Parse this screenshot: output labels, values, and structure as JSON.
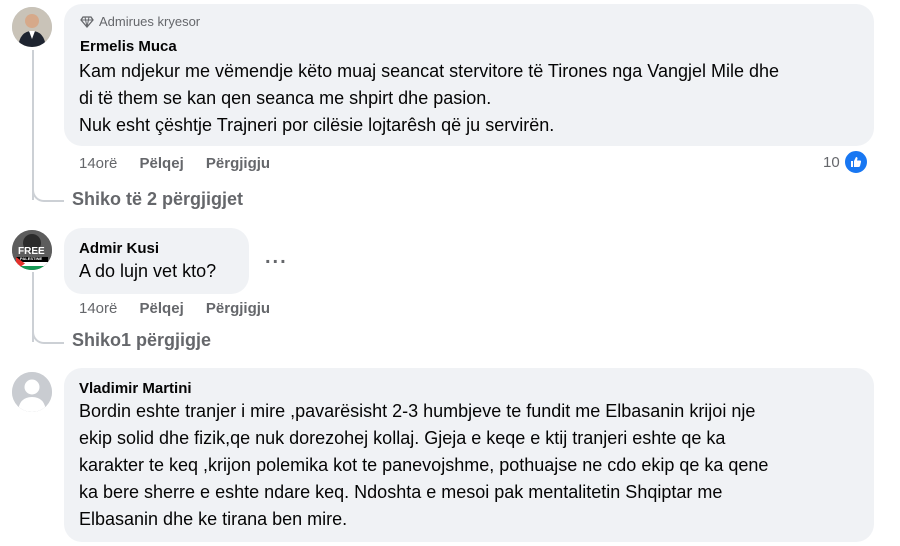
{
  "comments": [
    {
      "badge": "Admirues kryesor",
      "name": "Ermelis Muca",
      "lines": [
        "Kam ndjekur me vëmendje këto muaj seancat stervitore të Tirones nga Vangjel Mile dhe",
        "di të them se kan qen seanca me shpirt dhe pasion.",
        "Nuk esht çështje Trajneri por cilësie lojtarêsh që ju servirën."
      ],
      "time": "14orë",
      "like_label": "Pëlqej",
      "reply_label": "Përgjigju",
      "likes": "10",
      "view_replies": "Shiko të 2 përgjigjet"
    },
    {
      "name": "Admir Kusi",
      "lines": [
        "A do lujn vet kto?"
      ],
      "time": "14orë",
      "like_label": "Pëlqej",
      "reply_label": "Përgjigju",
      "more": "...",
      "view_replies": "Shiko1 përgjigje",
      "avatar_text": "FREE",
      "avatar_subtext": "PALESTINE"
    },
    {
      "name": "Vladimir Martini",
      "lines": [
        "Bordin eshte tranjer i mire ,pavarësisht 2-3 humbjeve te fundit me Elbasanin krijoi nje",
        "ekip solid dhe fizik,qe nuk dorezohej kollaj. Gjeja e keqe e ktij tranjeri eshte qe ka",
        "karakter te keq ,krijon polemika kot te panevojshme, pothuajse ne cdo ekip qe ka qene",
        "ka bere sherre e eshte ndare keq. Ndoshta e mesoi pak mentalitetin Shqiptar me",
        "Elbasanin dhe ke tirana ben mire."
      ]
    }
  ],
  "colors": {
    "bubble": "#f0f2f5",
    "secondary": "#65676b",
    "like_blue": "#1877f2",
    "thread_line": "#ccd0d5"
  }
}
